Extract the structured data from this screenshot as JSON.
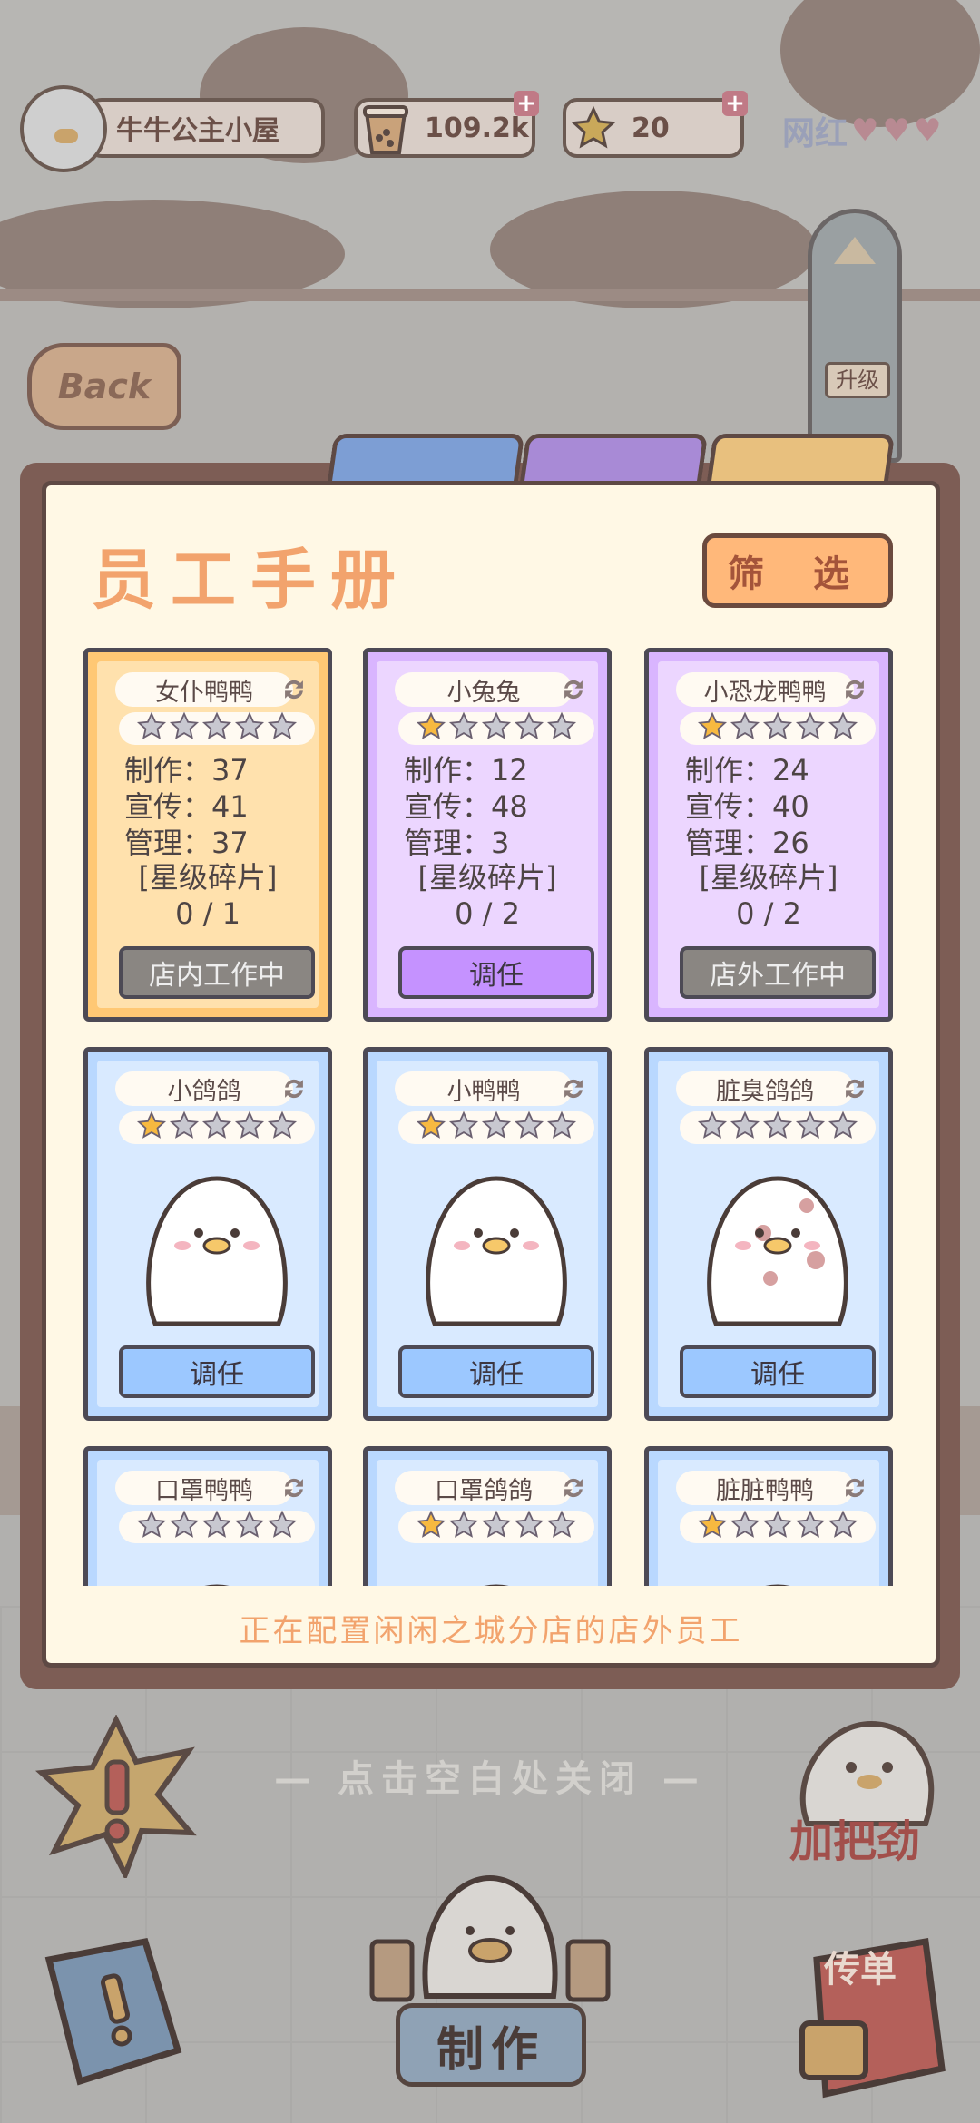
{
  "hud": {
    "shop_name": "牛牛公主小屋",
    "currency": "109.2k",
    "stars": "20",
    "fame_label": "网红"
  },
  "back_label": "Back",
  "upgrade_label": "升级",
  "panel": {
    "title": "员工手册",
    "filter_label": "筛 选",
    "footer_note": "正在配置闲闲之城分店的店外员工",
    "stat_labels": {
      "make": "制作：",
      "promo": "宣传：",
      "manage": "管理：",
      "shards": "[星级碎片]"
    }
  },
  "cards": [
    {
      "name": "女仆鸭鸭",
      "stars": 0,
      "theme": "orange",
      "make": "37",
      "promo": "41",
      "manage": "37",
      "shards": "0 / 1",
      "action": "店内工作中"
    },
    {
      "name": "小兔兔",
      "stars": 1,
      "theme": "purple",
      "make": "12",
      "promo": "48",
      "manage": "3",
      "shards": "0 / 2",
      "action": "调任"
    },
    {
      "name": "小恐龙鸭鸭",
      "stars": 1,
      "theme": "purple",
      "make": "24",
      "promo": "40",
      "manage": "26",
      "shards": "0 / 2",
      "action": "店外工作中"
    },
    {
      "name": "小鸽鸽",
      "stars": 1,
      "theme": "blue",
      "action": "调任"
    },
    {
      "name": "小鸭鸭",
      "stars": 1,
      "theme": "blue",
      "action": "调任"
    },
    {
      "name": "脏臭鸽鸽",
      "stars": 0,
      "theme": "blue",
      "action": "调任"
    },
    {
      "name": "口罩鸭鸭",
      "stars": 0,
      "theme": "blue"
    },
    {
      "name": "口罩鸽鸽",
      "stars": 1,
      "theme": "blue"
    },
    {
      "name": "脏脏鸭鸭",
      "stars": 1,
      "theme": "blue"
    }
  ],
  "close_hint": "— 点击空白处关闭 —",
  "bottom": {
    "make_label": "制作",
    "cheer_label": "加把劲",
    "flyer_label": "传单"
  },
  "colors": {
    "accent_orange": "#f2a36d",
    "card_orange": "#ffc874",
    "card_purple": "#d9b5ff",
    "card_blue": "#b9d8ff"
  }
}
